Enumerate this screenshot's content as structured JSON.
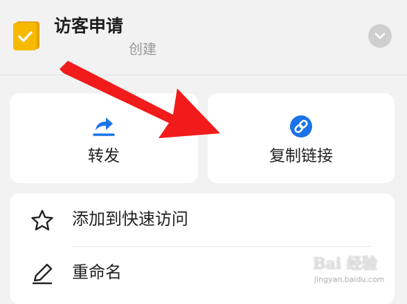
{
  "header": {
    "title": "访客申请",
    "subtitle": "创建",
    "app_icon": "folder-check-icon",
    "expand_icon": "chevron-down-icon"
  },
  "actions": [
    {
      "label": "转发",
      "icon": "share-forward-icon"
    },
    {
      "label": "复制链接",
      "icon": "link-icon"
    }
  ],
  "menu": [
    {
      "label": "添加到快速访问",
      "icon": "star-icon"
    },
    {
      "label": "重命名",
      "icon": "pencil-icon"
    }
  ],
  "watermark": {
    "main": "Bai 经验",
    "sub": "jingyan.baidu.com"
  },
  "colors": {
    "accent_blue": "#1a73e8",
    "folder_yellow": "#f5b800",
    "arrow_red": "#f21b1b"
  }
}
